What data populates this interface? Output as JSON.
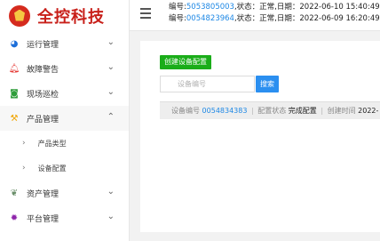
{
  "brand": {
    "title": "全控科技",
    "color": "#c8201a"
  },
  "sidebar": {
    "items": [
      {
        "label": "运行管理",
        "icon": "dashboard-icon",
        "expanded": false
      },
      {
        "label": "故障警告",
        "icon": "bell-icon",
        "expanded": false
      },
      {
        "label": "现场巡检",
        "icon": "camera-icon",
        "expanded": false
      },
      {
        "label": "产品管理",
        "icon": "hammer-icon",
        "expanded": true,
        "children": [
          {
            "label": "产品类型"
          },
          {
            "label": "设备配置"
          }
        ]
      },
      {
        "label": "资产管理",
        "icon": "leaf-icon",
        "expanded": false
      },
      {
        "label": "平台管理",
        "icon": "gear-icon",
        "expanded": false
      }
    ]
  },
  "header": {
    "notices": [
      {
        "prefix": "编号:",
        "code": "5053805003",
        "suffix": ",状态：正常,日期：2022-06-10 15:40:49"
      },
      {
        "prefix": "编号:",
        "code": "0054823964",
        "suffix": ",状态：正常,日期：2022-06-09 16:20:49"
      }
    ]
  },
  "main": {
    "create_button": "创建设备配置",
    "search_placeholder": "设备编号",
    "search_button": "搜索",
    "result": {
      "device_label": "设备编号",
      "device_value": "0054834383",
      "status_label": "配置状态",
      "status_value": "完成配置",
      "time_label": "创建时间",
      "time_value": "2022-"
    }
  },
  "colors": {
    "accent": "#2b8ff0",
    "create": "#1aad19",
    "link": "#1e88e5"
  }
}
